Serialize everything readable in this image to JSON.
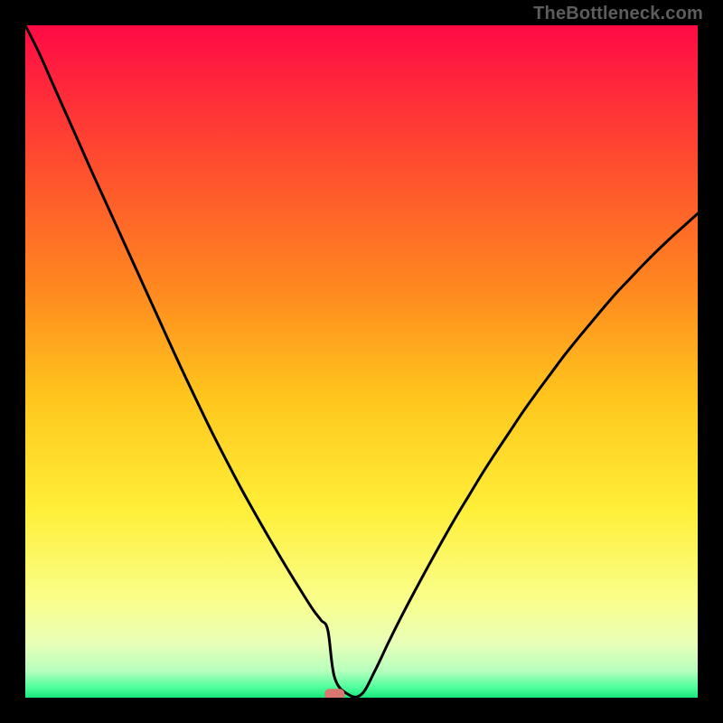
{
  "watermark": "TheBottleneck.com",
  "chart_data": {
    "type": "line",
    "title": "",
    "xlabel": "",
    "ylabel": "",
    "xlim": [
      0,
      100
    ],
    "ylim": [
      0,
      100
    ],
    "x": [
      0,
      2,
      4,
      6,
      8,
      10,
      12,
      14,
      16,
      18,
      20,
      22,
      24,
      26,
      28,
      30,
      32,
      34,
      36,
      38,
      40,
      42,
      43,
      44,
      45,
      46,
      48,
      50,
      52,
      54,
      56,
      58,
      60,
      62,
      64,
      66,
      68,
      70,
      72,
      74,
      76,
      78,
      80,
      82,
      84,
      86,
      88,
      90,
      92,
      94,
      96,
      98,
      100
    ],
    "values": [
      100,
      96,
      91.5,
      87,
      82.5,
      78,
      73.6,
      69.2,
      64.8,
      60.4,
      56,
      51.6,
      47.3,
      43.1,
      39,
      35.1,
      31.3,
      27.7,
      24.2,
      20.8,
      17.5,
      14.3,
      12.8,
      11.5,
      10.0,
      3.0,
      0.5,
      0.5,
      4.0,
      8.2,
      12.2,
      16.0,
      19.7,
      23.3,
      26.8,
      30.1,
      33.4,
      36.5,
      39.5,
      42.5,
      45.3,
      48.0,
      50.7,
      53.2,
      55.6,
      58.0,
      60.3,
      62.4,
      64.5,
      66.5,
      68.4,
      70.2,
      72.0
    ],
    "minimum_marker": {
      "x": 46,
      "y": 0.5
    },
    "gradient_stops": [
      {
        "offset": 0.0,
        "color": "#ff0a46"
      },
      {
        "offset": 0.2,
        "color": "#ff4b2f"
      },
      {
        "offset": 0.4,
        "color": "#ff8b1f"
      },
      {
        "offset": 0.55,
        "color": "#ffc51d"
      },
      {
        "offset": 0.72,
        "color": "#ffef38"
      },
      {
        "offset": 0.86,
        "color": "#f9ff8f"
      },
      {
        "offset": 0.92,
        "color": "#e8ffb8"
      },
      {
        "offset": 0.96,
        "color": "#b6ffbd"
      },
      {
        "offset": 0.985,
        "color": "#4dff9b"
      },
      {
        "offset": 1.0,
        "color": "#17e67c"
      }
    ]
  }
}
